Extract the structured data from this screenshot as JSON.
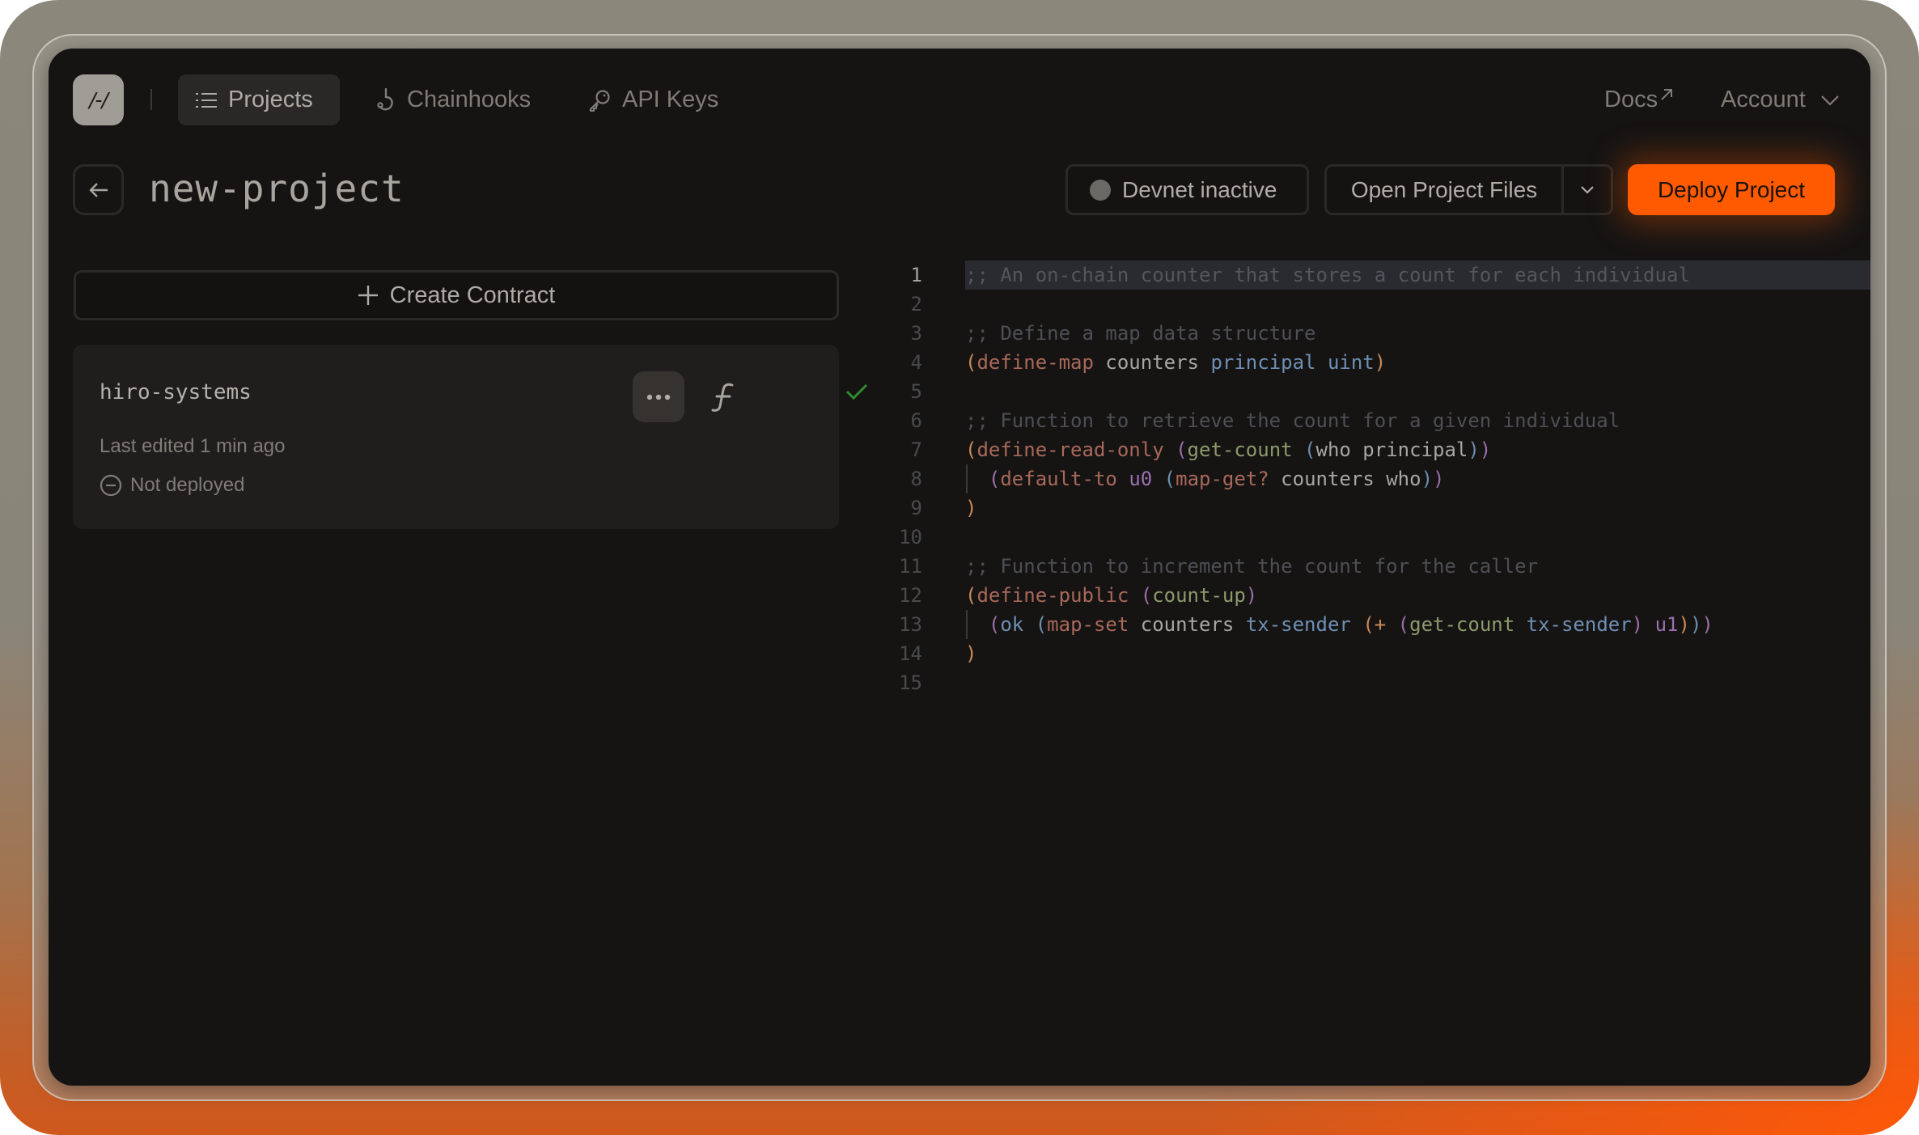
{
  "app": {
    "logo_text": "/-/",
    "nav": {
      "items": [
        {
          "label": "Projects",
          "icon": "list-icon",
          "active": true
        },
        {
          "label": "Chainhooks",
          "icon": "hook-icon",
          "active": false
        },
        {
          "label": "API Keys",
          "icon": "key-icon",
          "active": false
        }
      ],
      "docs_label": "Docs",
      "account_label": "Account"
    }
  },
  "header": {
    "project_title": "new-project",
    "devnet_status_label": "Devnet inactive",
    "open_files_label": "Open Project Files",
    "deploy_label": "Deploy Project"
  },
  "contracts": {
    "create_label": "Create Contract",
    "items": [
      {
        "name": "hiro-systems",
        "last_edited": "Last edited 1 min ago",
        "status": "Not deployed",
        "check_passed": true
      }
    ]
  },
  "editor": {
    "current_line": 1,
    "lines": [
      {
        "n": "1",
        "tokens": [
          {
            "t": ";; An on-chain counter that stores a count for each individual",
            "c": "c-hl-com"
          }
        ]
      },
      {
        "n": "2",
        "tokens": []
      },
      {
        "n": "3",
        "tokens": [
          {
            "t": ";; Define a map data structure",
            "c": "c-com"
          }
        ]
      },
      {
        "n": "4",
        "tokens": [
          {
            "t": "(",
            "c": "p1"
          },
          {
            "t": "define-map",
            "c": "c-kw"
          },
          {
            "t": " counters ",
            "c": "c-id"
          },
          {
            "t": "principal uint",
            "c": "c-type"
          },
          {
            "t": ")",
            "c": "p1"
          }
        ]
      },
      {
        "n": "5",
        "tokens": []
      },
      {
        "n": "6",
        "tokens": [
          {
            "t": ";; Function to retrieve the count for a given individual",
            "c": "c-com"
          }
        ]
      },
      {
        "n": "7",
        "tokens": [
          {
            "t": "(",
            "c": "p1"
          },
          {
            "t": "define-read-only ",
            "c": "c-kw"
          },
          {
            "t": "(",
            "c": "p2"
          },
          {
            "t": "get-count ",
            "c": "c-fn"
          },
          {
            "t": "(",
            "c": "p3"
          },
          {
            "t": "who principal",
            "c": "c-id"
          },
          {
            "t": ")",
            "c": "p3"
          },
          {
            "t": ")",
            "c": "p2"
          }
        ]
      },
      {
        "n": "8",
        "guide": true,
        "tokens": [
          {
            "t": "  ",
            "c": "c-id"
          },
          {
            "t": "(",
            "c": "p2"
          },
          {
            "t": "default-to ",
            "c": "c-kw"
          },
          {
            "t": "u0 ",
            "c": "c-num"
          },
          {
            "t": "(",
            "c": "p3"
          },
          {
            "t": "map-get? ",
            "c": "c-kw"
          },
          {
            "t": "counters who",
            "c": "c-id"
          },
          {
            "t": ")",
            "c": "p3"
          },
          {
            "t": ")",
            "c": "p2"
          }
        ]
      },
      {
        "n": "9",
        "tokens": [
          {
            "t": ")",
            "c": "p1"
          }
        ]
      },
      {
        "n": "10",
        "tokens": []
      },
      {
        "n": "11",
        "tokens": [
          {
            "t": ";; Function to increment the count for the caller",
            "c": "c-com"
          }
        ]
      },
      {
        "n": "12",
        "tokens": [
          {
            "t": "(",
            "c": "p1"
          },
          {
            "t": "define-public ",
            "c": "c-kw"
          },
          {
            "t": "(",
            "c": "p2"
          },
          {
            "t": "count-up",
            "c": "c-fn"
          },
          {
            "t": ")",
            "c": "p2"
          }
        ]
      },
      {
        "n": "13",
        "guide": true,
        "tokens": [
          {
            "t": "  ",
            "c": "c-id"
          },
          {
            "t": "(",
            "c": "p2"
          },
          {
            "t": "ok ",
            "c": "c-type"
          },
          {
            "t": "(",
            "c": "p3"
          },
          {
            "t": "map-set ",
            "c": "c-kw"
          },
          {
            "t": "counters ",
            "c": "c-id"
          },
          {
            "t": "tx-sender ",
            "c": "c-type"
          },
          {
            "t": "(",
            "c": "p1"
          },
          {
            "t": "+ ",
            "c": "p1"
          },
          {
            "t": "(",
            "c": "p2"
          },
          {
            "t": "get-count ",
            "c": "c-fn"
          },
          {
            "t": "tx-sender",
            "c": "c-type"
          },
          {
            "t": ") ",
            "c": "p2"
          },
          {
            "t": "u1",
            "c": "c-num"
          },
          {
            "t": ")",
            "c": "p1"
          },
          {
            "t": ")",
            "c": "p3"
          },
          {
            "t": ")",
            "c": "p2"
          }
        ]
      },
      {
        "n": "14",
        "tokens": [
          {
            "t": ")",
            "c": "p1"
          }
        ]
      },
      {
        "n": "15",
        "tokens": []
      }
    ]
  },
  "colors": {
    "accent": "#ff5a00",
    "panel_bg": "#151413",
    "card_bg": "#1f1e1d",
    "success": "#2e8b2e"
  }
}
